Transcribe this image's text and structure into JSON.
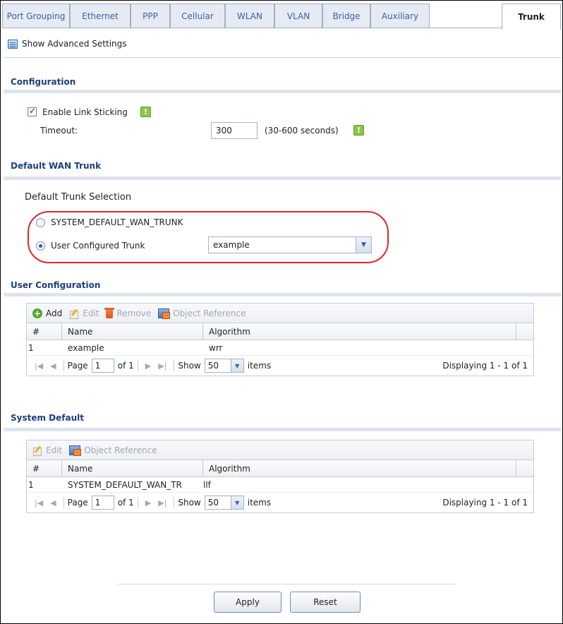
{
  "tabs": [
    {
      "label": "Port Grouping",
      "active": false
    },
    {
      "label": "Ethernet",
      "active": false
    },
    {
      "label": "PPP",
      "active": false
    },
    {
      "label": "Cellular",
      "active": false
    },
    {
      "label": "WLAN",
      "active": false
    },
    {
      "label": "VLAN",
      "active": false
    },
    {
      "label": "Bridge",
      "active": false
    },
    {
      "label": "Auxiliary",
      "active": false
    },
    {
      "label": "Trunk",
      "active": true
    }
  ],
  "advanced": {
    "label": "Show Advanced Settings"
  },
  "configuration": {
    "title": "Configuration",
    "enable_link_sticking_label": "Enable Link Sticking",
    "enable_link_sticking_checked": true,
    "timeout_label": "Timeout:",
    "timeout_value": "300",
    "timeout_hint": "(30-600 seconds)"
  },
  "default_wan": {
    "title": "Default WAN Trunk",
    "selection_label": "Default Trunk Selection",
    "option_system": "SYSTEM_DEFAULT_WAN_TRUNK",
    "option_user": "User Configured Trunk",
    "selected": "user",
    "user_trunk_value": "example"
  },
  "user_config": {
    "title": "User Configuration",
    "toolbar": {
      "add": "Add",
      "edit": "Edit",
      "remove": "Remove",
      "object_reference": "Object Reference"
    },
    "columns": [
      "#",
      "Name",
      "Algorithm"
    ],
    "rows": [
      {
        "num": "1",
        "name": "example",
        "algorithm": "wrr"
      }
    ],
    "pager": {
      "page_label": "Page",
      "page": "1",
      "of": "of 1",
      "show": "Show",
      "per_page": "50",
      "items": "items",
      "displaying": "Displaying 1 - 1 of 1"
    }
  },
  "system_default": {
    "title": "System Default",
    "toolbar": {
      "edit": "Edit",
      "object_reference": "Object Reference"
    },
    "columns": [
      "#",
      "Name",
      "Algorithm"
    ],
    "rows": [
      {
        "num": "1",
        "name": "SYSTEM_DEFAULT_WAN_TR",
        "algorithm": "llf"
      }
    ],
    "pager": {
      "page_label": "Page",
      "page": "1",
      "of": "of 1",
      "show": "Show",
      "per_page": "50",
      "items": "items",
      "displaying": "Displaying 1 - 1 of 1"
    }
  },
  "buttons": {
    "apply": "Apply",
    "reset": "Reset"
  }
}
